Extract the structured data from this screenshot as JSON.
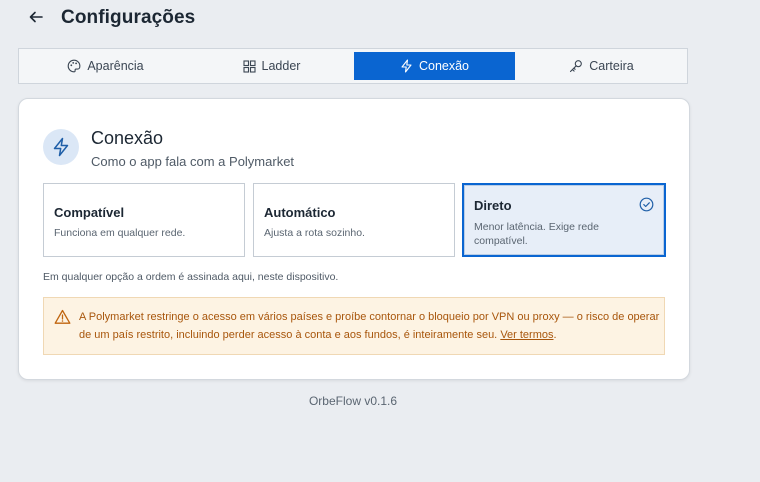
{
  "header": {
    "title": "Configurações"
  },
  "tabs": [
    {
      "label": "Aparência",
      "icon": "palette-icon",
      "active": false
    },
    {
      "label": "Ladder",
      "icon": "grid-icon",
      "active": false
    },
    {
      "label": "Conexão",
      "icon": "lightning-icon",
      "active": true
    },
    {
      "label": "Carteira",
      "icon": "key-icon",
      "active": false
    }
  ],
  "section": {
    "icon": "lightning-icon",
    "title": "Conexão",
    "subtitle": "Como o app fala com a Polymarket"
  },
  "options": [
    {
      "title": "Compatível",
      "description": "Funciona em qualquer rede.",
      "selected": false
    },
    {
      "title": "Automático",
      "description": "Ajusta a rota sozinho.",
      "selected": false
    },
    {
      "title": "Direto",
      "description": "Menor latência. Exige rede compatível.",
      "selected": true
    }
  ],
  "note": "Em qualquer opção a ordem é assinada aqui, neste dispositivo.",
  "warning": {
    "text": "A Polymarket restringe o acesso em vários países e proíbe contornar o bloqueio por VPN ou proxy — o risco de operar de um país restrito, incluindo perder acesso à conta e aos fundos, é inteiramente seu. ",
    "link": "Ver termos",
    "suffix": "."
  },
  "footer": {
    "version": "OrbeFlow v0.1.6"
  },
  "colors": {
    "accent": "#0a65d1",
    "warning_text": "#a8560c",
    "warning_bg": "#fdf3e3"
  }
}
